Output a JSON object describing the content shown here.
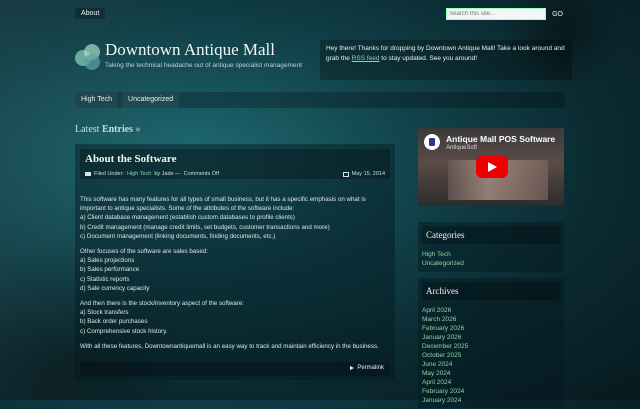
{
  "top": {
    "about_label": "About",
    "search_placeholder": "Search this site...",
    "go_label": "GO"
  },
  "site": {
    "title": "Downtown Antique Mall",
    "tagline": "Taking the technical headache out of antique specialist management"
  },
  "welcome": {
    "prefix": "Hey there! Thanks for dropping by Downtown Antique Mall! Take a look around and grab the ",
    "link": "RSS feed",
    "suffix": " to stay updated. See you around!"
  },
  "nav": [
    "High Tech",
    "Uncategorized"
  ],
  "latest": {
    "prefix": "Latest ",
    "bold": "Entries",
    "suffix": " »"
  },
  "post": {
    "title": "About the Software",
    "filed_under": "Filed Under: ",
    "category": "High Tech",
    "by": " by Jade — ",
    "comments": "Comments Off",
    "date": "May 15, 2014",
    "paragraphs": [
      [
        "This software has many features for all types of small business, but it has a specific emphasis on what is",
        "important to antique specialists. Some of the attributes of the software include:",
        "a) Client database management (establish custom databases to profile clients)",
        "b) Credit management (manage credit limits, set budgets, customer transactions and more)",
        "c) Document management (linking documents, finding documents, etc.)"
      ],
      [
        "Other focuses of the software are sales based:",
        "a) Sales projections",
        "b) Sales performance",
        "c) Statistic reports",
        "d) Sale currency capacity"
      ],
      [
        "And then there is the stock/inventory aspect of the software:",
        "a) Stock transfers",
        "b) Back order purchases",
        "c) Comprehensive stock history."
      ],
      [
        "With all these features, Downtownantiquemall is an easy way to track and maintain efficiency in the business."
      ]
    ],
    "permalink": "Permalink"
  },
  "video": {
    "title": "Antique Mall POS Software",
    "channel": "AntiqueSoft"
  },
  "categories": {
    "title": "Categories",
    "items": [
      "High Tech",
      "Uncategorized"
    ]
  },
  "archives": {
    "title": "Archives",
    "items": [
      "April 2026",
      "March 2026",
      "February 2026",
      "January 2026",
      "December 2025",
      "October 2025",
      "June 2024",
      "May 2024",
      "April 2024",
      "February 2024",
      "January 2024"
    ]
  },
  "colors": {
    "link": "#8fd3a8",
    "background": "#12444c",
    "youtube_red": "#e00000"
  }
}
